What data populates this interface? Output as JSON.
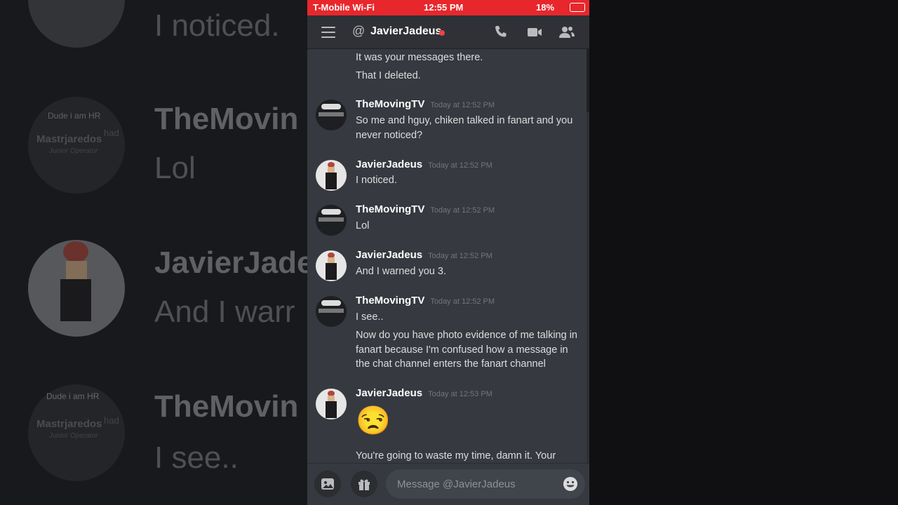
{
  "status_bar": {
    "carrier": "T-Mobile Wi-Fi",
    "time": "12:55 PM",
    "battery": "18%"
  },
  "header": {
    "at_symbol": "@",
    "channel_name": "JavierJadeus",
    "status_color": "#ed4245",
    "icons": [
      "hamburger-menu-icon",
      "call-icon",
      "video-icon",
      "members-icon"
    ]
  },
  "messages": {
    "continuation": {
      "lines": [
        "It was your messages there.",
        "That I deleted."
      ]
    },
    "groups": [
      {
        "author": "TheMovingTV",
        "timestamp": "Today at 12:52 PM",
        "lines": [
          "So me and hguy, chiken talked in fanart and you never noticed?"
        ]
      },
      {
        "author": "JavierJadeus",
        "timestamp": "Today at 12:52 PM",
        "lines": [
          "I noticed."
        ]
      },
      {
        "author": "TheMovingTV",
        "timestamp": "Today at 12:52 PM",
        "lines": [
          "Lol"
        ]
      },
      {
        "author": "JavierJadeus",
        "timestamp": "Today at 12:52 PM",
        "lines": [
          "And I warned you 3."
        ]
      },
      {
        "author": "TheMovingTV",
        "timestamp": "Today at 12:52 PM",
        "lines": [
          "I see..",
          "Now do you have photo evidence of me talking in fanart because I'm confused how a message in the chat channel enters the fanart channel"
        ]
      },
      {
        "author": "JavierJadeus",
        "timestamp": "Today at 12:53 PM",
        "emoji": "😒",
        "lines": [
          "You're going to waste my time, damn it. Your"
        ]
      }
    ]
  },
  "input": {
    "placeholder": "Message @JavierJadeus"
  },
  "background": {
    "items": [
      "I noticed.",
      "TheMovin",
      "Lol",
      "JavierJade",
      "And I warr",
      "TheMovin",
      "I see..",
      "Dude i am HR",
      "Mastrjaredos",
      "Junior Operator",
      "had"
    ]
  }
}
